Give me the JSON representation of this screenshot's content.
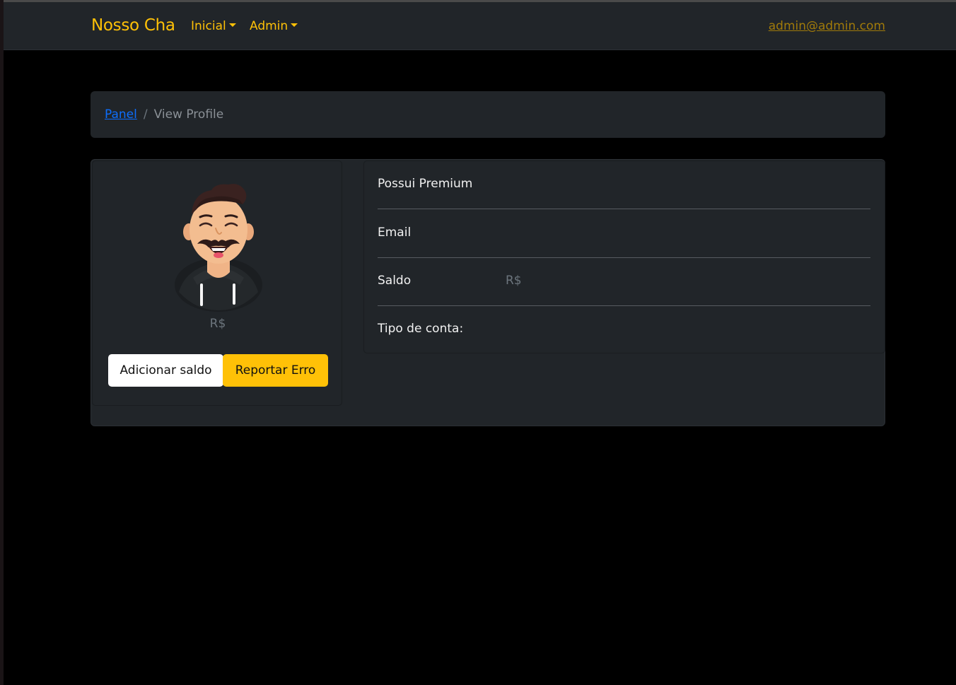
{
  "navbar": {
    "brand": "Nosso Cha",
    "items": [
      {
        "label": "Inicial"
      },
      {
        "label": "Admin"
      }
    ],
    "user_email": "admin@admin.com"
  },
  "breadcrumb": {
    "link": "Panel",
    "separator": "/",
    "current": "View Profile"
  },
  "profile": {
    "balance": "R$",
    "add_balance_label": "Adicionar saldo",
    "report_error_label": "Reportar Erro"
  },
  "info": {
    "rows": [
      {
        "label": "Possui Premium",
        "value": ""
      },
      {
        "label": "Email",
        "value": ""
      },
      {
        "label": "Saldo",
        "value": "R$"
      },
      {
        "label": "Tipo de conta:",
        "value": ""
      }
    ]
  },
  "colors": {
    "accent": "#ffc107",
    "link": "#0d6efd",
    "panel": "#212529",
    "background": "#000000"
  }
}
